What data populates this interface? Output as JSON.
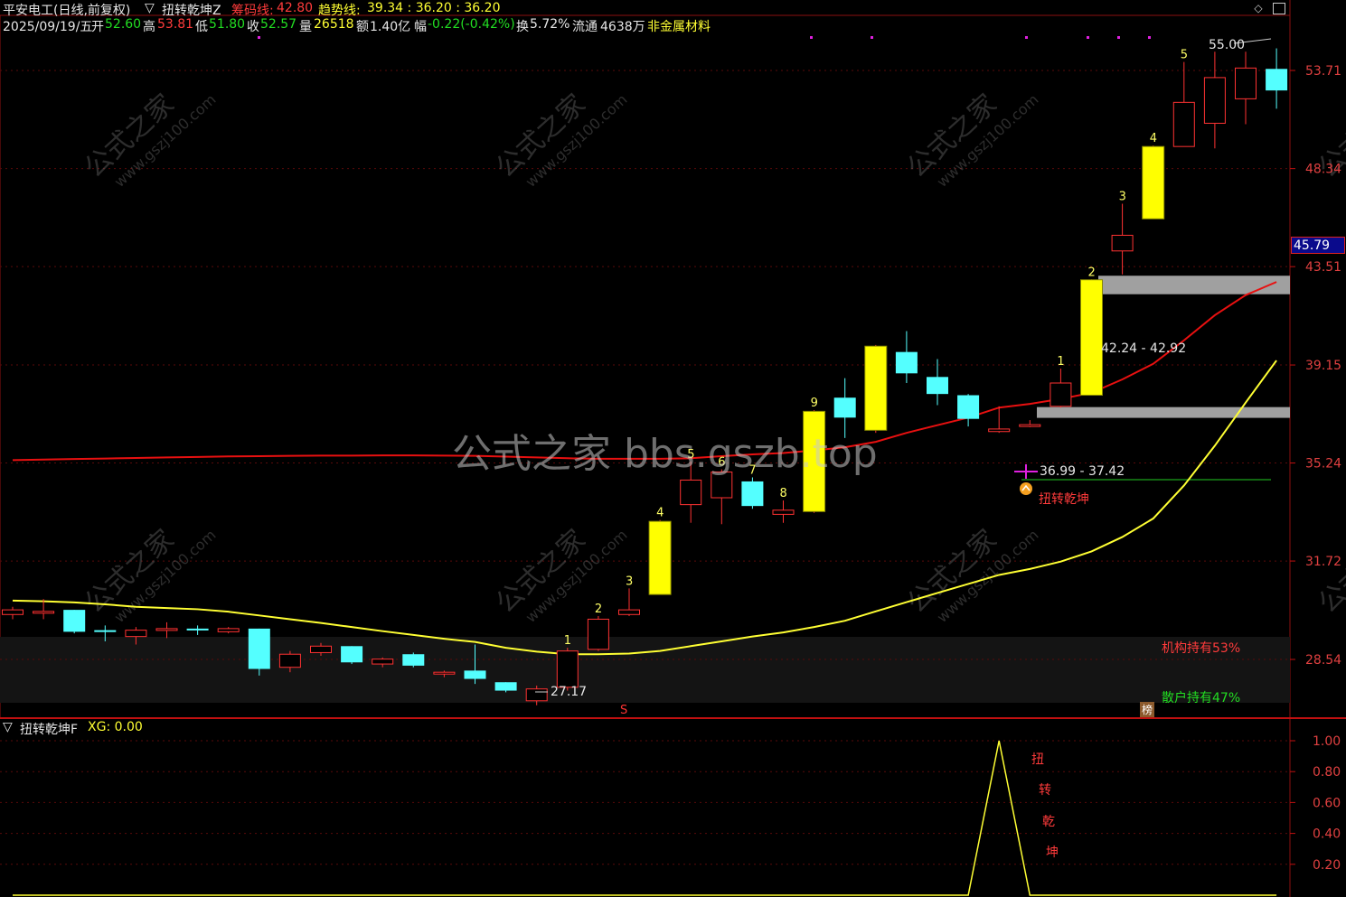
{
  "header": {
    "stock_title": "平安电工(日线,前复权)",
    "indicator_name": "扭转乾坤Z",
    "chip_line_label": "筹码线:",
    "chip_line_value": "42.80",
    "trend_line_label": "趋势线:",
    "trend_line_values": "39.34 : 36.20 : 36.20",
    "date": "2025/09/19/五",
    "open_label": "开",
    "open_value": "52.60",
    "high_label": "高",
    "high_value": "53.81",
    "low_label": "低",
    "low_value": "51.80",
    "close_label": "收",
    "close_value": "52.57",
    "volume_label": "量",
    "volume_value": "26518",
    "amount_label": "额",
    "amount_value": "1.40亿",
    "change_label": "幅",
    "change_value": "-0.22(-0.42%)",
    "turnover_label": "换",
    "turnover_value": "5.72%",
    "float_label": "流通",
    "float_value": "4638万",
    "sector": "非金属材料"
  },
  "watermark": {
    "center": "公式之家 bbs.gszb.top",
    "diag_cn": "公式之家",
    "diag_url": "www.gszj100.com"
  },
  "price_axis": {
    "ticks": [
      "53.71",
      "48.34",
      "43.51",
      "39.15",
      "35.24",
      "31.72",
      "28.54"
    ],
    "current_price_badge": "45.79"
  },
  "annotations": {
    "max_price": "55.00",
    "min_price": "27.17",
    "zone_upper_label": "42.24 - 42.92",
    "zone_lower_label": "36.99 - 37.42",
    "signal_label": "扭转乾坤",
    "institution_label": "机构持有53%",
    "retail_label": "散户持有47%",
    "marker_s": "S",
    "marker_bang": "榜"
  },
  "sub_panel": {
    "title": "扭转乾坤F",
    "xg_label": "XG: 0.00",
    "ticks": [
      "1.00",
      "0.80",
      "0.60",
      "0.40",
      "0.20"
    ],
    "signal_chars": [
      "扭",
      "转",
      "乾",
      "坤"
    ]
  },
  "colors": {
    "up": "#ff3232",
    "down": "#54ffff",
    "highlight": "#ffff00",
    "chip_line": "#e81010",
    "trend_line": "#ffff33",
    "panel_border": "#a01010",
    "zone_band": "#a0a0a0"
  },
  "chart_data": [
    {
      "type": "candlestick",
      "title": "平安电工(日线,前复权)",
      "y_ticks": [
        53.71,
        48.34,
        43.51,
        39.15,
        35.24,
        31.72,
        28.54
      ],
      "candles": [
        {
          "o": 29.95,
          "h": 30.2,
          "l": 29.8,
          "c": 30.1,
          "count": ""
        },
        {
          "o": 30.05,
          "h": 30.45,
          "l": 29.8,
          "c": 30.05,
          "count": ""
        },
        {
          "o": 30.1,
          "h": 30.1,
          "l": 29.35,
          "c": 29.4,
          "count": ""
        },
        {
          "o": 29.45,
          "h": 29.6,
          "l": 29.1,
          "c": 29.4,
          "count": ""
        },
        {
          "o": 29.25,
          "h": 29.55,
          "l": 29.0,
          "c": 29.45,
          "count": ""
        },
        {
          "o": 29.45,
          "h": 29.7,
          "l": 29.2,
          "c": 29.5,
          "count": ""
        },
        {
          "o": 29.5,
          "h": 29.6,
          "l": 29.3,
          "c": 29.45,
          "count": ""
        },
        {
          "o": 29.4,
          "h": 29.55,
          "l": 29.35,
          "c": 29.5,
          "count": ""
        },
        {
          "o": 29.5,
          "h": 29.5,
          "l": 28.05,
          "c": 28.25,
          "count": ""
        },
        {
          "o": 28.3,
          "h": 28.8,
          "l": 28.15,
          "c": 28.7,
          "count": ""
        },
        {
          "o": 28.75,
          "h": 29.05,
          "l": 28.65,
          "c": 28.95,
          "count": ""
        },
        {
          "o": 28.95,
          "h": 28.95,
          "l": 28.4,
          "c": 28.45,
          "count": ""
        },
        {
          "o": 28.4,
          "h": 28.6,
          "l": 28.3,
          "c": 28.55,
          "count": ""
        },
        {
          "o": 28.7,
          "h": 28.75,
          "l": 28.3,
          "c": 28.35,
          "count": ""
        },
        {
          "o": 28.1,
          "h": 28.2,
          "l": 28.0,
          "c": 28.15,
          "count": ""
        },
        {
          "o": 28.2,
          "h": 29.0,
          "l": 27.8,
          "c": 27.95,
          "count": ""
        },
        {
          "o": 27.85,
          "h": 27.85,
          "l": 27.55,
          "c": 27.6,
          "count": ""
        },
        {
          "o": 27.3,
          "h": 27.75,
          "l": 27.17,
          "c": 27.65,
          "count": ""
        },
        {
          "o": 27.7,
          "h": 28.9,
          "l": 27.6,
          "c": 28.8,
          "count": "1"
        },
        {
          "o": 28.85,
          "h": 29.9,
          "l": 28.8,
          "c": 29.8,
          "count": "2"
        },
        {
          "o": 29.95,
          "h": 30.8,
          "l": 29.9,
          "c": 30.1,
          "count": "3"
        },
        {
          "o": 30.6,
          "h": 33.15,
          "l": 30.6,
          "c": 33.1,
          "count": "4",
          "highlight": true
        },
        {
          "o": 33.7,
          "h": 35.3,
          "l": 33.05,
          "c": 34.6,
          "count": "5"
        },
        {
          "o": 33.95,
          "h": 35.0,
          "l": 33.0,
          "c": 34.9,
          "count": "6"
        },
        {
          "o": 34.55,
          "h": 34.7,
          "l": 33.55,
          "c": 33.65,
          "count": "7"
        },
        {
          "o": 33.35,
          "h": 33.85,
          "l": 33.05,
          "c": 33.5,
          "count": "8"
        },
        {
          "o": 33.45,
          "h": 37.3,
          "l": 33.4,
          "c": 37.25,
          "count": "9",
          "highlight": true
        },
        {
          "o": 37.8,
          "h": 38.6,
          "l": 36.2,
          "c": 37.0,
          "count": ""
        },
        {
          "o": 36.5,
          "h": 40.0,
          "l": 36.4,
          "c": 39.95,
          "count": "",
          "highlight": true
        },
        {
          "o": 39.7,
          "h": 40.6,
          "l": 38.4,
          "c": 38.8,
          "count": ""
        },
        {
          "o": 38.65,
          "h": 39.4,
          "l": 37.5,
          "c": 37.95,
          "count": ""
        },
        {
          "o": 37.9,
          "h": 37.95,
          "l": 36.65,
          "c": 36.95,
          "count": ""
        },
        {
          "o": 36.45,
          "h": 37.45,
          "l": 36.4,
          "c": 36.55,
          "count": ""
        },
        {
          "o": 36.72,
          "h": 36.9,
          "l": 36.62,
          "c": 36.72,
          "count": ""
        },
        {
          "o": 37.45,
          "h": 39.0,
          "l": 37.4,
          "c": 38.4,
          "count": "1"
        },
        {
          "o": 37.9,
          "h": 42.92,
          "l": 37.9,
          "c": 42.9,
          "count": "2",
          "highlight": true
        },
        {
          "o": 44.25,
          "h": 46.55,
          "l": 43.15,
          "c": 45.0,
          "count": "3"
        },
        {
          "o": 45.8,
          "h": 49.55,
          "l": 45.8,
          "c": 49.5,
          "count": "4",
          "highlight": true
        },
        {
          "o": 49.5,
          "h": 54.2,
          "l": 49.5,
          "c": 51.9,
          "count": "5"
        },
        {
          "o": 50.75,
          "h": 54.8,
          "l": 49.4,
          "c": 53.3,
          "count": ""
        },
        {
          "o": 52.1,
          "h": 54.8,
          "l": 50.7,
          "c": 53.85,
          "count": ""
        },
        {
          "o": 53.8,
          "h": 55.0,
          "l": 51.55,
          "c": 52.57,
          "count": ""
        }
      ],
      "series": [
        {
          "name": "筹码线",
          "values": [
            35.35,
            35.37,
            35.39,
            35.41,
            35.43,
            35.45,
            35.47,
            35.49,
            35.5,
            35.51,
            35.52,
            35.52,
            35.53,
            35.53,
            35.52,
            35.51,
            35.48,
            35.45,
            35.42,
            35.4,
            35.4,
            35.4,
            35.42,
            35.5,
            35.57,
            35.62,
            35.72,
            35.84,
            36.05,
            36.4,
            36.7,
            37.0,
            37.4,
            37.55,
            37.75,
            38.0,
            38.55,
            39.2,
            40.2,
            41.3,
            42.2,
            42.8
          ]
        },
        {
          "name": "趋势线",
          "values": [
            30.4,
            30.38,
            30.34,
            30.28,
            30.2,
            30.16,
            30.12,
            30.04,
            29.92,
            29.8,
            29.68,
            29.55,
            29.42,
            29.3,
            29.18,
            29.08,
            28.9,
            28.78,
            28.7,
            28.7,
            28.72,
            28.8,
            28.95,
            29.1,
            29.25,
            29.38,
            29.55,
            29.75,
            30.05,
            30.35,
            30.65,
            30.95,
            31.25,
            31.45,
            31.7,
            32.05,
            32.55,
            33.2,
            34.4,
            35.9,
            37.6,
            39.34
          ]
        }
      ],
      "ranges": [
        {
          "low": 42.24,
          "high": 42.92,
          "label": "42.24 - 42.92"
        },
        {
          "low": 36.99,
          "high": 37.42,
          "label": "36.99 - 37.42"
        }
      ],
      "max_label": "55.00",
      "min_label": "27.17",
      "signal": "扭转乾坤"
    },
    {
      "type": "line",
      "title": "扭转乾坤F",
      "y_ticks": [
        1.0,
        0.8,
        0.6,
        0.4,
        0.2
      ],
      "series": [
        {
          "name": "XG",
          "values": [
            0,
            0,
            0,
            0,
            0,
            0,
            0,
            0,
            0,
            0,
            0,
            0,
            0,
            0,
            0,
            0,
            0,
            0,
            0,
            0,
            0,
            0,
            0,
            0,
            0,
            0,
            0,
            0,
            0,
            0,
            0,
            0,
            1,
            0,
            0,
            0,
            0,
            0,
            0,
            0,
            0,
            0
          ]
        }
      ]
    }
  ]
}
